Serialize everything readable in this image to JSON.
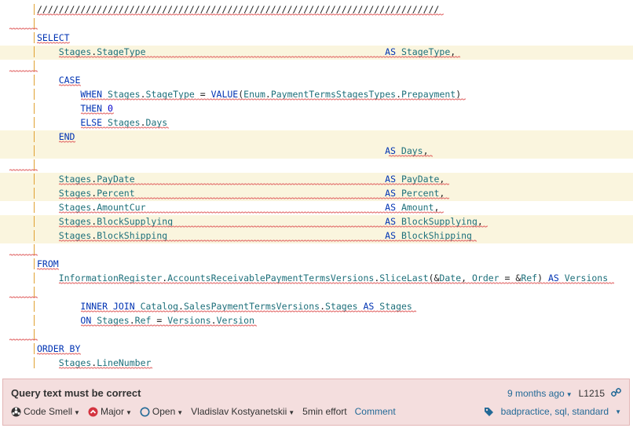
{
  "code_lines": [
    {
      "tokens": [
        [
          "pl",
          "//////////////////////////////////////////////////////////////////////////"
        ]
      ],
      "bar": true
    },
    {
      "tokens": [],
      "bar": true
    },
    {
      "tokens": [
        [
          "kw",
          "SELECT"
        ]
      ],
      "bar": true
    },
    {
      "tokens": [
        [
          "pl",
          "    "
        ],
        [
          "id",
          "Stages"
        ],
        [
          "pl",
          "."
        ],
        [
          "id",
          "StageType"
        ],
        [
          "pl",
          "                                            "
        ],
        [
          "kw",
          "AS"
        ],
        [
          "pl",
          " "
        ],
        [
          "id",
          "StageType"
        ],
        [
          "pl",
          ","
        ]
      ],
      "bar": true,
      "hl": true
    },
    {
      "tokens": [],
      "bar": true
    },
    {
      "tokens": [
        [
          "pl",
          "    "
        ],
        [
          "kw",
          "CASE"
        ]
      ],
      "bar": true
    },
    {
      "tokens": [
        [
          "pl",
          "        "
        ],
        [
          "kw",
          "WHEN"
        ],
        [
          "pl",
          " "
        ],
        [
          "id",
          "Stages"
        ],
        [
          "pl",
          "."
        ],
        [
          "id",
          "StageType"
        ],
        [
          "pl",
          " = "
        ],
        [
          "kw",
          "VALUE"
        ],
        [
          "pl",
          "("
        ],
        [
          "id",
          "Enum"
        ],
        [
          "pl",
          "."
        ],
        [
          "id",
          "PaymentTermsStagesTypes"
        ],
        [
          "pl",
          "."
        ],
        [
          "id",
          "Prepayment"
        ],
        [
          "pl",
          ")"
        ]
      ],
      "bar": true
    },
    {
      "tokens": [
        [
          "pl",
          "        "
        ],
        [
          "kw",
          "THEN"
        ],
        [
          "pl",
          " "
        ],
        [
          "num",
          "0"
        ]
      ],
      "bar": true
    },
    {
      "tokens": [
        [
          "pl",
          "        "
        ],
        [
          "kw",
          "ELSE"
        ],
        [
          "pl",
          " "
        ],
        [
          "id",
          "Stages"
        ],
        [
          "pl",
          "."
        ],
        [
          "id",
          "Days"
        ]
      ],
      "bar": true
    },
    {
      "tokens": [
        [
          "pl",
          "    "
        ],
        [
          "kw",
          "END"
        ]
      ],
      "bar": true,
      "hl": true
    },
    {
      "tokens": [
        [
          "pl",
          "                                                                "
        ],
        [
          "kw",
          "AS"
        ],
        [
          "pl",
          " "
        ],
        [
          "id",
          "Days"
        ],
        [
          "pl",
          ","
        ]
      ],
      "bar": true,
      "hl": true
    },
    {
      "tokens": [],
      "bar": true
    },
    {
      "tokens": [
        [
          "pl",
          "    "
        ],
        [
          "id",
          "Stages"
        ],
        [
          "pl",
          "."
        ],
        [
          "id",
          "PayDate"
        ],
        [
          "pl",
          "                                              "
        ],
        [
          "kw",
          "AS"
        ],
        [
          "pl",
          " "
        ],
        [
          "id",
          "PayDate"
        ],
        [
          "pl",
          ","
        ]
      ],
      "bar": true,
      "hl": true
    },
    {
      "tokens": [
        [
          "pl",
          "    "
        ],
        [
          "id",
          "Stages"
        ],
        [
          "pl",
          "."
        ],
        [
          "id",
          "Percent"
        ],
        [
          "pl",
          "                                              "
        ],
        [
          "kw",
          "AS"
        ],
        [
          "pl",
          " "
        ],
        [
          "id",
          "Percent"
        ],
        [
          "pl",
          ","
        ]
      ],
      "bar": true,
      "hl": true
    },
    {
      "tokens": [
        [
          "pl",
          "    "
        ],
        [
          "id",
          "Stages"
        ],
        [
          "pl",
          "."
        ],
        [
          "id",
          "AmountCur"
        ],
        [
          "pl",
          "                                            "
        ],
        [
          "kw",
          "AS"
        ],
        [
          "pl",
          " "
        ],
        [
          "id",
          "Amount"
        ],
        [
          "pl",
          ","
        ]
      ],
      "bar": true
    },
    {
      "tokens": [
        [
          "pl",
          "    "
        ],
        [
          "id",
          "Stages"
        ],
        [
          "pl",
          "."
        ],
        [
          "id",
          "BlockSupplying"
        ],
        [
          "pl",
          "                                       "
        ],
        [
          "kw",
          "AS"
        ],
        [
          "pl",
          " "
        ],
        [
          "id",
          "BlockSupplying"
        ],
        [
          "pl",
          ","
        ]
      ],
      "bar": true,
      "hl": true
    },
    {
      "tokens": [
        [
          "pl",
          "    "
        ],
        [
          "id",
          "Stages"
        ],
        [
          "pl",
          "."
        ],
        [
          "id",
          "BlockShipping"
        ],
        [
          "pl",
          "                                        "
        ],
        [
          "kw",
          "AS"
        ],
        [
          "pl",
          " "
        ],
        [
          "id",
          "BlockShipping"
        ]
      ],
      "bar": true,
      "hl": true
    },
    {
      "tokens": [],
      "bar": true
    },
    {
      "tokens": [
        [
          "kw",
          "FROM"
        ]
      ],
      "bar": true
    },
    {
      "tokens": [
        [
          "pl",
          "    "
        ],
        [
          "id",
          "InformationRegister"
        ],
        [
          "pl",
          "."
        ],
        [
          "id",
          "AccountsReceivablePaymentTermsVersions"
        ],
        [
          "pl",
          "."
        ],
        [
          "id",
          "SliceLast"
        ],
        [
          "pl",
          "(&"
        ],
        [
          "id",
          "Date"
        ],
        [
          "pl",
          ", "
        ],
        [
          "id",
          "Order"
        ],
        [
          "pl",
          " = &"
        ],
        [
          "id",
          "Ref"
        ],
        [
          "pl",
          ") "
        ],
        [
          "kw",
          "AS"
        ],
        [
          "pl",
          " "
        ],
        [
          "id",
          "Versions"
        ]
      ],
      "bar": true
    },
    {
      "tokens": [],
      "bar": true
    },
    {
      "tokens": [
        [
          "pl",
          "        "
        ],
        [
          "kw",
          "INNER JOIN"
        ],
        [
          "pl",
          " "
        ],
        [
          "id",
          "Catalog"
        ],
        [
          "pl",
          "."
        ],
        [
          "id",
          "SalesPaymentTermsVersions"
        ],
        [
          "pl",
          "."
        ],
        [
          "id",
          "Stages"
        ],
        [
          "pl",
          " "
        ],
        [
          "kw",
          "AS"
        ],
        [
          "pl",
          " "
        ],
        [
          "id",
          "Stages"
        ]
      ],
      "bar": true
    },
    {
      "tokens": [
        [
          "pl",
          "        "
        ],
        [
          "kw",
          "ON"
        ],
        [
          "pl",
          " "
        ],
        [
          "id",
          "Stages"
        ],
        [
          "pl",
          "."
        ],
        [
          "id",
          "Ref"
        ],
        [
          "pl",
          " = "
        ],
        [
          "id",
          "Versions"
        ],
        [
          "pl",
          "."
        ],
        [
          "id",
          "Version"
        ]
      ],
      "bar": true
    },
    {
      "tokens": [],
      "bar": true
    },
    {
      "tokens": [
        [
          "kw",
          "ORDER BY"
        ]
      ],
      "bar": true
    },
    {
      "tokens": [
        [
          "pl",
          "    "
        ],
        [
          "id",
          "Stages"
        ],
        [
          "pl",
          "."
        ],
        [
          "id",
          "LineNumber"
        ]
      ],
      "bar": true
    }
  ],
  "issue": {
    "title": "Query text must be correct",
    "age": "9 months ago",
    "line": "L1215",
    "type": "Code Smell",
    "severity": "Major",
    "status": "Open",
    "assignee": "Vladislav Kostyanetskii",
    "effort": "5min effort",
    "comment": "Comment",
    "tags": "badpractice, sql, standard"
  },
  "colors": {
    "highlight": "#faf5de",
    "issue_bg": "#f4dede",
    "link": "#236a97",
    "keyword": "#0033b3"
  }
}
